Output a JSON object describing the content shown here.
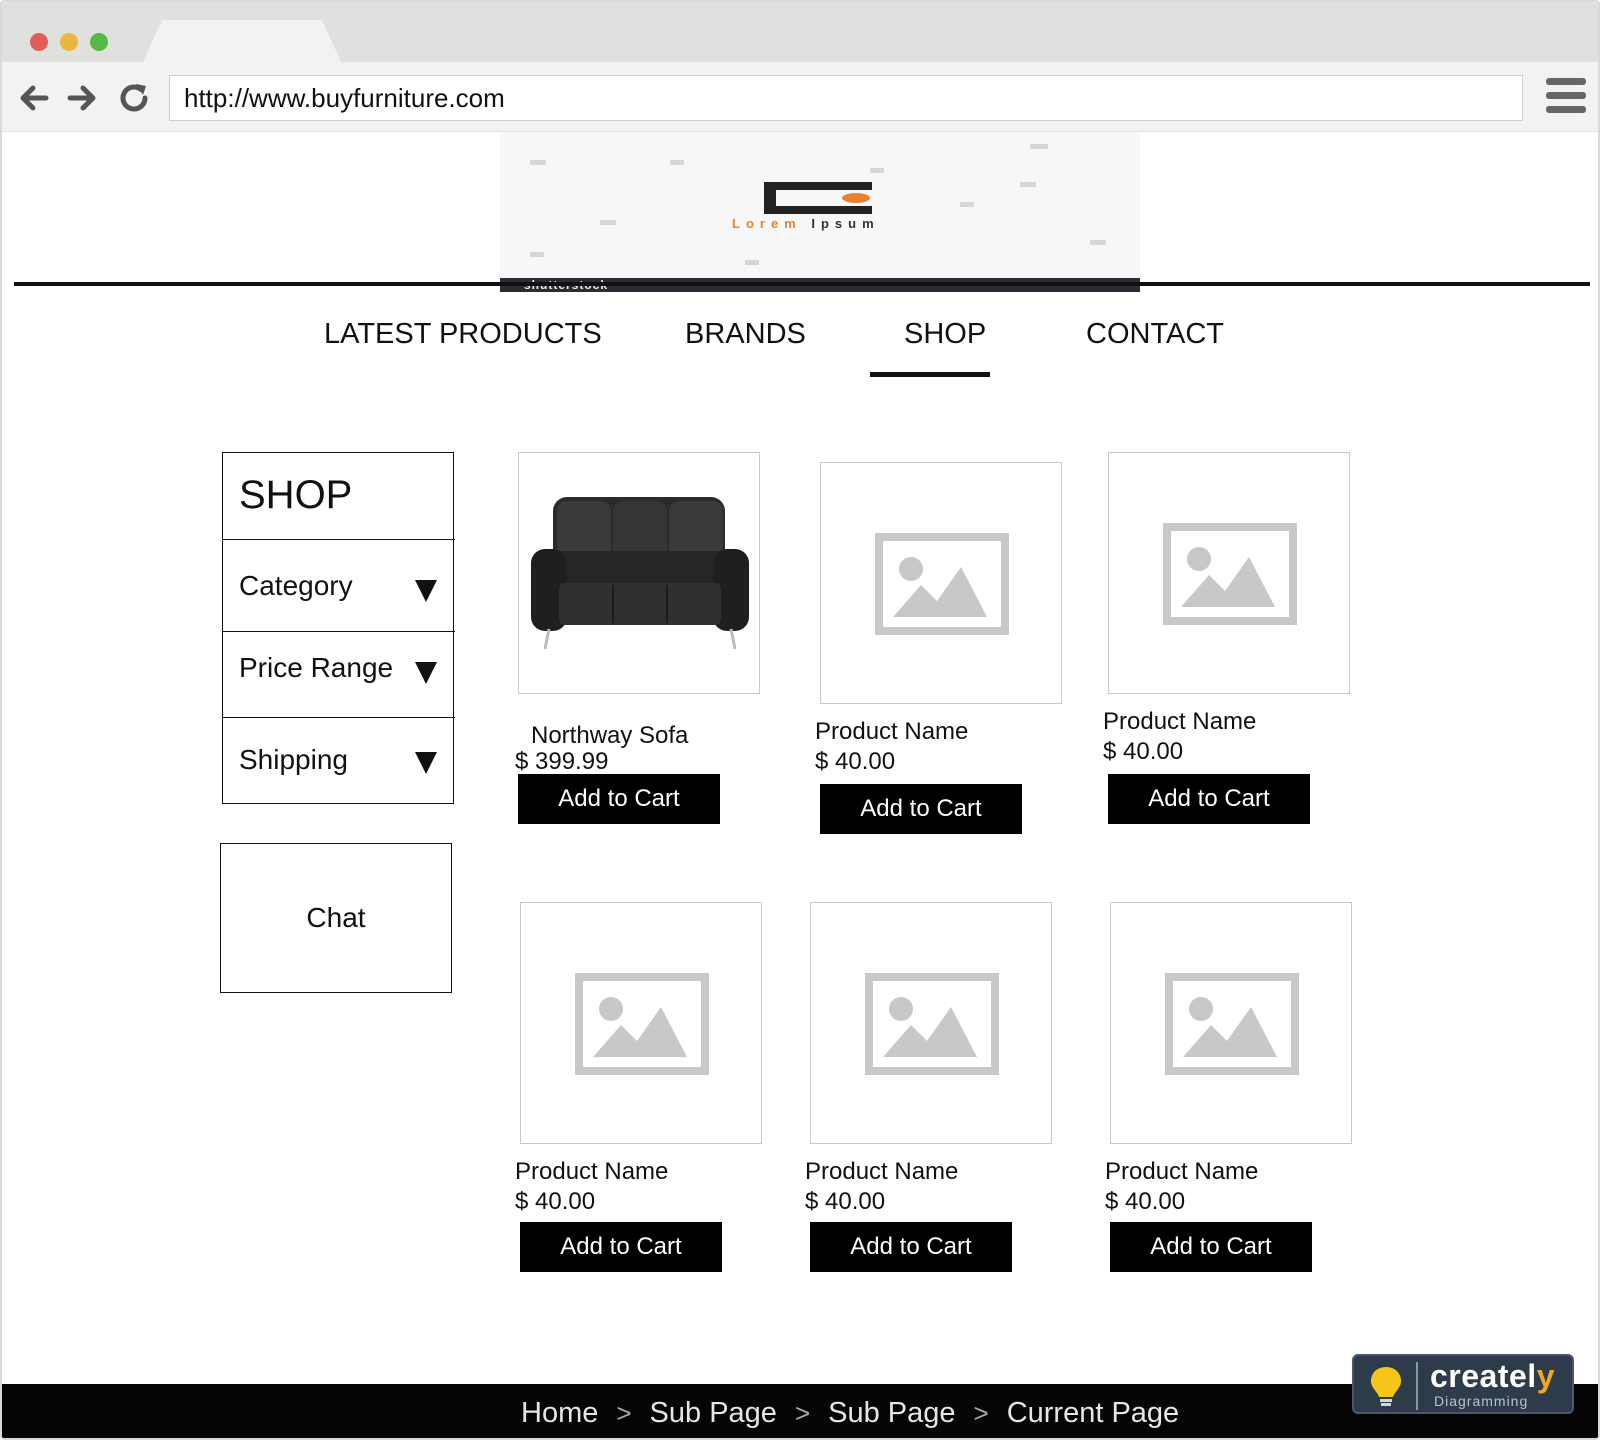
{
  "browser": {
    "url": "http://www.buyfurniture.com",
    "icons": [
      "back-arrow-icon",
      "forward-arrow-icon",
      "reload-icon",
      "hamburger-menu-icon"
    ]
  },
  "logo": {
    "lorem": "Lorem",
    "ipsum": "Ipsum",
    "watermark": "shutterstock"
  },
  "nav": {
    "items": [
      {
        "label": "LATEST PRODUCTS",
        "active": false
      },
      {
        "label": "BRANDS",
        "active": false
      },
      {
        "label": "SHOP",
        "active": true
      },
      {
        "label": "CONTACT",
        "active": false
      }
    ]
  },
  "sidebar": {
    "title": "SHOP",
    "filters": [
      {
        "label": "Category"
      },
      {
        "label": "Price Range"
      },
      {
        "label": "Shipping"
      }
    ],
    "chat_label": "Chat"
  },
  "products": [
    {
      "name": "Northway Sofa",
      "price": "$ 399.99",
      "button": "Add to Cart",
      "image": "sofa"
    },
    {
      "name": "Product Name",
      "price": "$ 40.00",
      "button": "Add to Cart",
      "image": "placeholder"
    },
    {
      "name": "Product Name",
      "price": "$ 40.00",
      "button": "Add to Cart",
      "image": "placeholder"
    },
    {
      "name": "Product Name",
      "price": "$ 40.00",
      "button": "Add to Cart",
      "image": "placeholder"
    },
    {
      "name": "Product Name",
      "price": "$ 40.00",
      "button": "Add to Cart",
      "image": "placeholder"
    },
    {
      "name": "Product Name",
      "price": "$ 40.00",
      "button": "Add to Cart",
      "image": "placeholder"
    }
  ],
  "breadcrumb": {
    "items": [
      "Home",
      "Sub Page",
      "Sub Page",
      "Current Page"
    ],
    "separator": ">"
  },
  "watermark_badge": {
    "brand_main": "createl",
    "brand_end": "y",
    "tagline": "Diagramming"
  },
  "colors": {
    "button_bg": "#000000",
    "placeholder_gray": "#c8c8c8",
    "logo_orange": "#e8822e",
    "footer_bg": "#050505"
  }
}
